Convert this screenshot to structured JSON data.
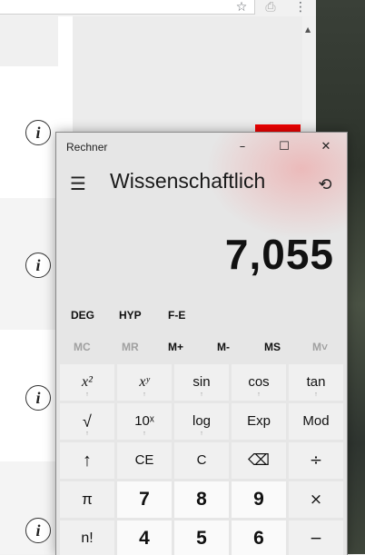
{
  "browser": {
    "icons": [
      "star-icon",
      "pdf-icon",
      "more-vert-icon"
    ],
    "star_glyph": "☆",
    "pdf_glyph": "⎙",
    "more_glyph": "⋮"
  },
  "page": {
    "info_glyph": "i",
    "scroll_up_glyph": "▲"
  },
  "calculator": {
    "title": "Rechner",
    "window_buttons": {
      "minimize": "–",
      "maximize": "☐",
      "close": "✕"
    },
    "menu_glyph": "☰",
    "mode": "Wissenschaftlich",
    "history_glyph": "⟲",
    "display_value": "7,055",
    "toggles": [
      "DEG",
      "HYP",
      "F-E"
    ],
    "memory": [
      {
        "label": "MC",
        "enabled": false
      },
      {
        "label": "MR",
        "enabled": false
      },
      {
        "label": "M+",
        "enabled": true
      },
      {
        "label": "M-",
        "enabled": true
      },
      {
        "label": "MS",
        "enabled": true
      },
      {
        "label": "M˅",
        "enabled": false
      }
    ],
    "keys": {
      "r1": [
        "x²",
        "xʸ",
        "sin",
        "cos",
        "tan"
      ],
      "r2": [
        "√",
        "10ˣ",
        "log",
        "Exp",
        "Mod"
      ],
      "r3": [
        "↑",
        "CE",
        "C",
        "⌫",
        "÷"
      ],
      "r4": [
        "π",
        "7",
        "8",
        "9",
        "×"
      ],
      "r5": [
        "n!",
        "4",
        "5",
        "6",
        "−"
      ]
    },
    "tick": "↑"
  },
  "colors": {
    "accent_red": "#e00000",
    "calc_bg": "#e6e6e6"
  }
}
